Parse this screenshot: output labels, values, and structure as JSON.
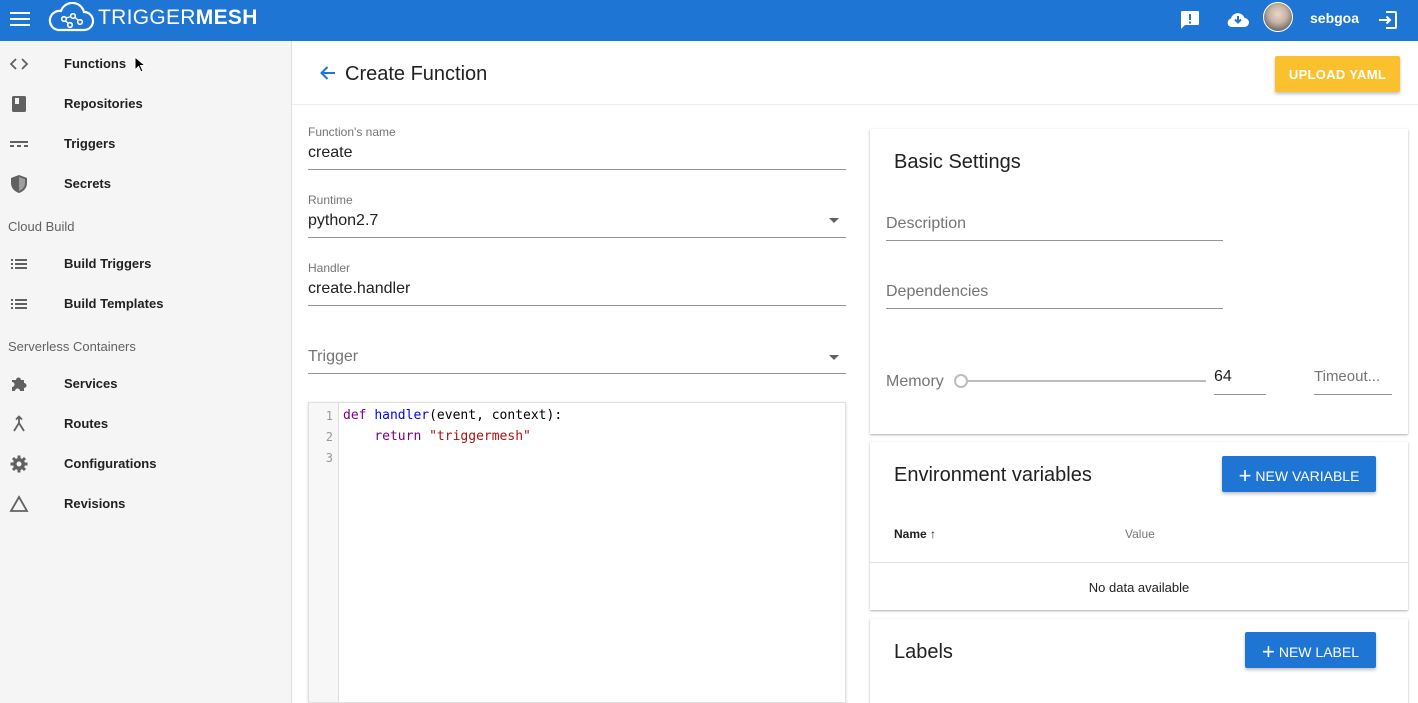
{
  "topbar": {
    "brand_light": "TRIGGER",
    "brand_bold": "MESH",
    "username": "sebgoa",
    "color": "#1e75d3"
  },
  "sidebar": {
    "items": [
      {
        "label": "Functions",
        "icon": "code-icon"
      },
      {
        "label": "Repositories",
        "icon": "book-icon"
      },
      {
        "label": "Triggers",
        "icon": "triggers-icon"
      },
      {
        "label": "Secrets",
        "icon": "shield-icon"
      }
    ],
    "section_cloud_build": "Cloud Build",
    "cloud_build_items": [
      {
        "label": "Build Triggers",
        "icon": "list-icon"
      },
      {
        "label": "Build Templates",
        "icon": "list-icon"
      }
    ],
    "section_serverless": "Serverless Containers",
    "serverless_items": [
      {
        "label": "Services",
        "icon": "puzzle-icon"
      },
      {
        "label": "Routes",
        "icon": "merge-icon"
      },
      {
        "label": "Configurations",
        "icon": "gear-icon"
      },
      {
        "label": "Revisions",
        "icon": "triangle-icon"
      }
    ]
  },
  "header": {
    "title": "Create Function",
    "upload_label": "UPLOAD YAML",
    "upload_color": "#fbc02d"
  },
  "form": {
    "name_label": "Function's name",
    "name_value": "create",
    "runtime_label": "Runtime",
    "runtime_value": "python2.7",
    "handler_label": "Handler",
    "handler_value": "create.handler",
    "trigger_placeholder": "Trigger"
  },
  "editor": {
    "line_numbers": [
      "1",
      "2",
      "3"
    ],
    "code": {
      "kw_def": "def",
      "fn_name": "handler",
      "params": "(event, context):",
      "kw_return": "return",
      "str_value": "\"triggermesh\""
    }
  },
  "basic_settings": {
    "title": "Basic Settings",
    "description_placeholder": "Description",
    "dependencies_placeholder": "Dependencies",
    "memory_label": "Memory",
    "memory_value": "64",
    "timeout_placeholder": "Timeout..."
  },
  "env_vars": {
    "title": "Environment variables",
    "new_label": "NEW VARIABLE",
    "col_name": "Name",
    "col_value": "Value",
    "empty_text": "No data available"
  },
  "labels": {
    "title": "Labels",
    "new_label": "NEW LABEL"
  }
}
